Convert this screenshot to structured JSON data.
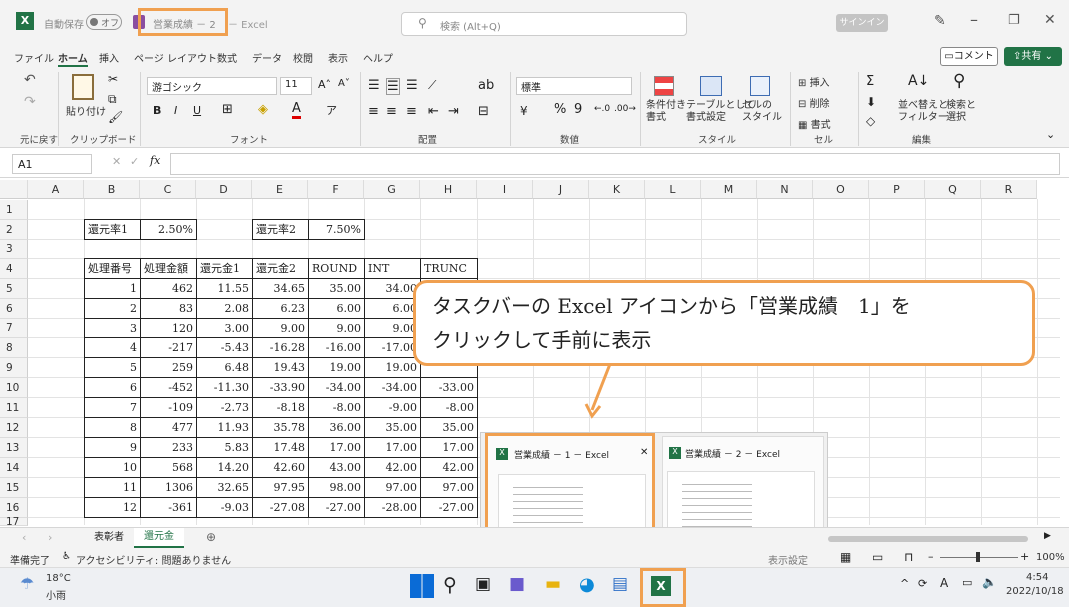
{
  "titlebar": {
    "autosave_label": "自動保存",
    "autosave_state": "オフ",
    "doc_title": "営業成績 － 2",
    "app_suffix": "－ Excel",
    "search_placeholder": "検索 (Alt+Q)",
    "signin": "サインイン"
  },
  "menu": {
    "items": [
      "ファイル",
      "ホーム",
      "挿入",
      "ページ レイアウト",
      "数式",
      "データ",
      "校閲",
      "表示",
      "ヘルプ"
    ],
    "comment": "コメント",
    "share": "共有"
  },
  "ribbon": {
    "undo_group": "元に戻す",
    "paste": "貼り付け",
    "clipboard": "クリップボード",
    "font_name": "游ゴシック",
    "font_size": "11",
    "font_group": "フォント",
    "align_group": "配置",
    "number_format": "標準",
    "number_group": "数値",
    "cond_format": "条件付き\n書式",
    "table_format": "テーブルとして\n書式設定",
    "cell_style": "セルの\nスタイル",
    "style_group": "スタイル",
    "insert": "挿入",
    "delete": "削除",
    "format": "書式",
    "cell_group": "セル",
    "sort": "並べ替えと\nフィルター",
    "find": "検索と\n選択",
    "edit_group": "編集",
    "bold": "B",
    "italic": "I",
    "underline": "U",
    "percent": "%",
    "comma": "9"
  },
  "formula": {
    "cellref": "A1",
    "fx": "fx",
    "value": ""
  },
  "columns": [
    "A",
    "B",
    "C",
    "D",
    "E",
    "F",
    "G",
    "H",
    "I",
    "J",
    "K",
    "L",
    "M",
    "N",
    "O",
    "P",
    "Q",
    "R"
  ],
  "rows": [
    "1",
    "2",
    "3",
    "4",
    "5",
    "6",
    "7",
    "8",
    "9",
    "10",
    "11",
    "12",
    "13",
    "14",
    "15",
    "16",
    "17"
  ],
  "cells": {
    "b2": "還元率1",
    "c2": "2.50%",
    "e2": "還元率2",
    "f2": "7.50%",
    "headers": [
      "処理番号",
      "処理金額",
      "還元金1",
      "還元金2",
      "ROUND",
      "INT",
      "TRUNC"
    ],
    "data": [
      [
        "1",
        "462",
        "11.55",
        "34.65",
        "35.00",
        "34.00",
        ""
      ],
      [
        "2",
        "83",
        "2.08",
        "6.23",
        "6.00",
        "6.00",
        ""
      ],
      [
        "3",
        "120",
        "3.00",
        "9.00",
        "9.00",
        "9.00",
        ""
      ],
      [
        "4",
        "-217",
        "-5.43",
        "-16.28",
        "-16.00",
        "-17.00",
        ""
      ],
      [
        "5",
        "259",
        "6.48",
        "19.43",
        "19.00",
        "19.00",
        ""
      ],
      [
        "6",
        "-452",
        "-11.30",
        "-33.90",
        "-34.00",
        "-34.00",
        "-33.00"
      ],
      [
        "7",
        "-109",
        "-2.73",
        "-8.18",
        "-8.00",
        "-9.00",
        "-8.00"
      ],
      [
        "8",
        "477",
        "11.93",
        "35.78",
        "36.00",
        "35.00",
        "35.00"
      ],
      [
        "9",
        "233",
        "5.83",
        "17.48",
        "17.00",
        "17.00",
        "17.00"
      ],
      [
        "10",
        "568",
        "14.20",
        "42.60",
        "43.00",
        "42.00",
        "42.00"
      ],
      [
        "11",
        "1306",
        "32.65",
        "97.95",
        "98.00",
        "97.00",
        "97.00"
      ],
      [
        "12",
        "-361",
        "-9.03",
        "-27.08",
        "-27.00",
        "-28.00",
        "-27.00"
      ]
    ]
  },
  "sheets": [
    "表彰者",
    "還元金"
  ],
  "status": {
    "ready": "準備完了",
    "accessibility": "アクセシビリティ: 問題ありません",
    "display_settings": "表示設定",
    "zoom": "100%"
  },
  "callout": {
    "line1": "タスクバーの Excel アイコンから「営業成績　1」を",
    "line2": "クリックして手前に表示"
  },
  "preview": {
    "thumb1": "営業成績 － 1 － Excel",
    "thumb2": "営業成績 － 2 － Excel"
  },
  "taskbar": {
    "temp": "18°C",
    "weather": "小雨",
    "time": "4:54",
    "date": "2022/10/18"
  },
  "colors": {
    "excel_green": "#217346",
    "accent_orange": "#f0a050"
  }
}
